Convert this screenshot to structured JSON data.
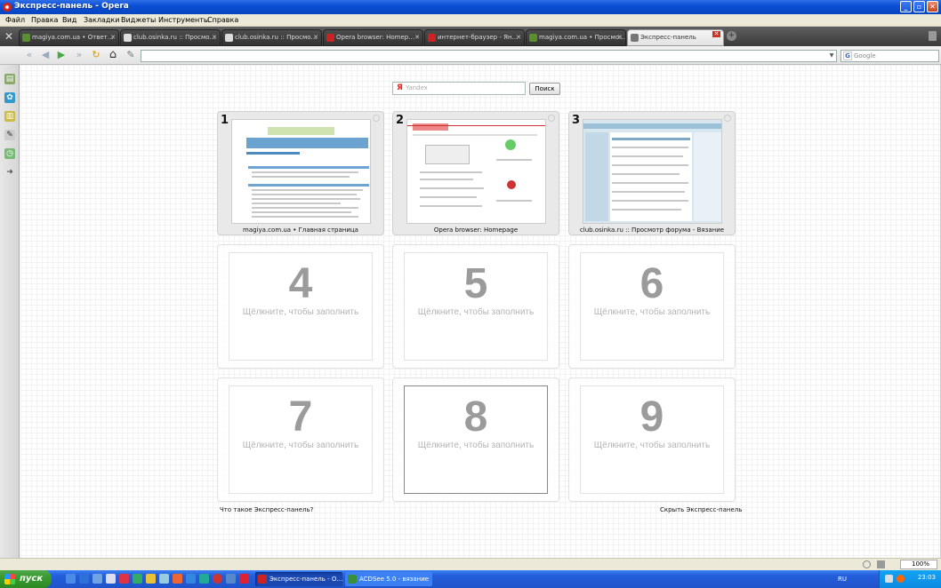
{
  "window": {
    "title": "Экспресс-панель - Opera"
  },
  "menu": [
    "Файл",
    "Правка",
    "Вид",
    "Закладки",
    "Виджеты",
    "Инструменты",
    "Справка"
  ],
  "tabs": [
    {
      "label": "magiya.com.ua • Ответ…",
      "favicon_color": "#5a8f2e"
    },
    {
      "label": "club.osinka.ru :: Просмо…",
      "favicon_color": "#dddddd"
    },
    {
      "label": "club.osinka.ru :: Просмо…",
      "favicon_color": "#dddddd"
    },
    {
      "label": "Opera browser: Homep…",
      "favicon_color": "#cc2222"
    },
    {
      "label": "интернет-браузер - Ян…",
      "favicon_color": "#cc2222"
    },
    {
      "label": "magiya.com.ua • Просмо…",
      "favicon_color": "#5a8f2e"
    },
    {
      "label": "Экспресс-панель",
      "favicon_color": "#777777",
      "active": true
    }
  ],
  "search": {
    "engine": "Google"
  },
  "speeddial": {
    "search_placeholder": "Yandex",
    "search_logo": "Я",
    "search_button": "Поиск",
    "cells": [
      {
        "num": "1",
        "caption": "magiya.com.ua • Главная страница",
        "filled": true
      },
      {
        "num": "2",
        "caption": "Opera browser: Homepage",
        "filled": true
      },
      {
        "num": "3",
        "caption": "club.osinka.ru :: Просмотр форума - Вязание",
        "filled": true
      },
      {
        "num": "4",
        "hint": "Щёлкните, чтобы заполнить"
      },
      {
        "num": "5",
        "hint": "Щёлкните, чтобы заполнить"
      },
      {
        "num": "6",
        "hint": "Щёлкните, чтобы заполнить"
      },
      {
        "num": "7",
        "hint": "Щёлкните, чтобы заполнить"
      },
      {
        "num": "8",
        "hint": "Щёлкните, чтобы заполнить"
      },
      {
        "num": "9",
        "hint": "Щёлкните, чтобы заполнить"
      }
    ],
    "what_is_link": "Что такое Экспресс-панель?",
    "hide_link": "Скрыть Экспресс-панель"
  },
  "statusbar": {
    "zoom": "100%"
  },
  "taskbar": {
    "start": "пуск",
    "items": [
      {
        "label": "Экспресс-панель - О…",
        "icon_color": "#cc2222"
      },
      {
        "label": "ACDSee 5.0 - вязание",
        "icon_color": "#3a8f3a"
      }
    ],
    "lang": "RU",
    "clock": "23:03"
  }
}
